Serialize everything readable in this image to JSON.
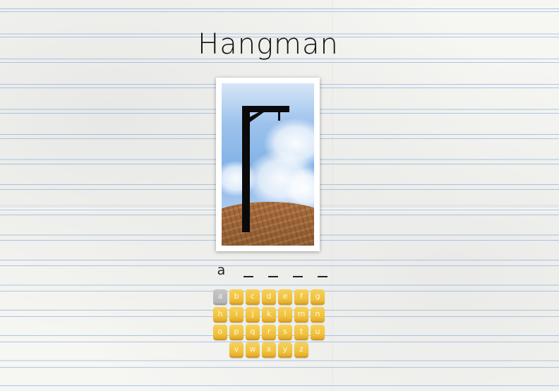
{
  "game": {
    "title": "Hangman",
    "word_slots": [
      {
        "char": "a",
        "revealed": true
      },
      {
        "char": "",
        "revealed": false
      },
      {
        "char": "",
        "revealed": false
      },
      {
        "char": "",
        "revealed": false
      },
      {
        "char": "",
        "revealed": false
      }
    ],
    "keyboard_rows": [
      [
        {
          "letter": "a",
          "used": true
        },
        {
          "letter": "b",
          "used": false
        },
        {
          "letter": "c",
          "used": false
        },
        {
          "letter": "d",
          "used": false
        },
        {
          "letter": "e",
          "used": false
        },
        {
          "letter": "f",
          "used": false
        },
        {
          "letter": "g",
          "used": false
        }
      ],
      [
        {
          "letter": "h",
          "used": false
        },
        {
          "letter": "i",
          "used": false
        },
        {
          "letter": "j",
          "used": false
        },
        {
          "letter": "k",
          "used": false
        },
        {
          "letter": "l",
          "used": false
        },
        {
          "letter": "m",
          "used": false
        },
        {
          "letter": "n",
          "used": false
        }
      ],
      [
        {
          "letter": "o",
          "used": false
        },
        {
          "letter": "p",
          "used": false
        },
        {
          "letter": "q",
          "used": false
        },
        {
          "letter": "r",
          "used": false
        },
        {
          "letter": "s",
          "used": false
        },
        {
          "letter": "t",
          "used": false
        },
        {
          "letter": "u",
          "used": false
        }
      ],
      [
        {
          "letter": "v",
          "used": false
        },
        {
          "letter": "w",
          "used": false
        },
        {
          "letter": "x",
          "used": false
        },
        {
          "letter": "y",
          "used": false
        },
        {
          "letter": "z",
          "used": false
        }
      ]
    ],
    "wrong_guesses": 0
  },
  "colors": {
    "key_active": "#f0c13c",
    "key_used": "#b4b4b4",
    "paper_line": "#7da5dc"
  }
}
